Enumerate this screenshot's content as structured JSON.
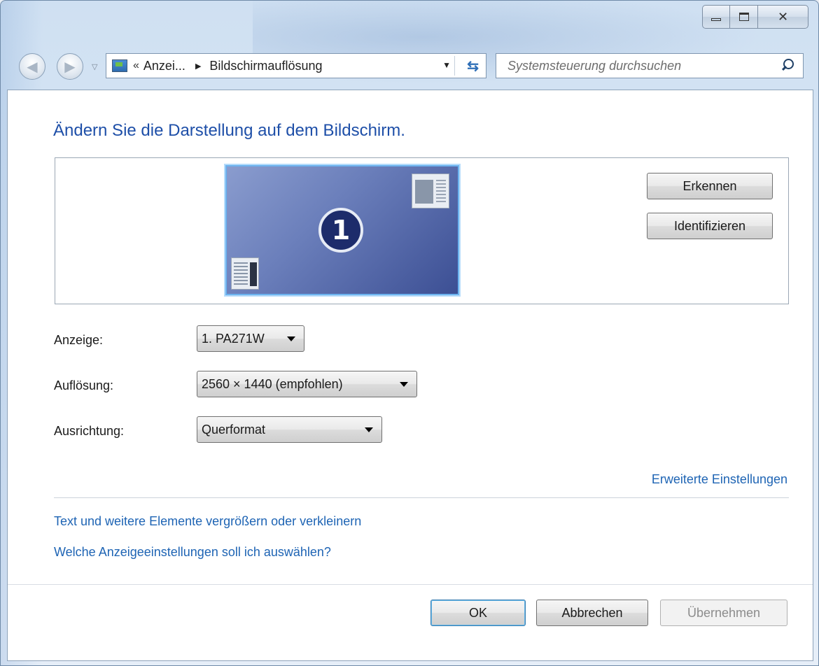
{
  "window": {
    "caption_icons": [
      "minimize-icon",
      "maximize-icon",
      "close-icon"
    ]
  },
  "nav": {
    "address_chevron": "«",
    "breadcrumb_parent": "Anzei...",
    "breadcrumb_current": "Bildschirmauflösung",
    "search_placeholder": "Systemsteuerung durchsuchen"
  },
  "main": {
    "title": "Ändern Sie die Darstellung auf dem Bildschirm.",
    "monitor_number": "1",
    "detect_button": "Erkennen",
    "identify_button": "Identifizieren",
    "fields": {
      "display_label": "Anzeige:",
      "display_value": "1. PA271W",
      "resolution_label": "Auflösung:",
      "resolution_value": "2560 × 1440 (empfohlen)",
      "orientation_label": "Ausrichtung:",
      "orientation_value": "Querformat"
    },
    "advanced_link": "Erweiterte Einstellungen",
    "text_size_link": "Text und weitere Elemente vergrößern oder verkleinern",
    "help_link": "Welche Anzeigeeinstellungen soll ich auswählen?"
  },
  "footer": {
    "ok": "OK",
    "cancel": "Abbrechen",
    "apply": "Übernehmen"
  },
  "colors": {
    "title_blue": "#1e4fa8",
    "link_blue": "#1e64b4"
  }
}
